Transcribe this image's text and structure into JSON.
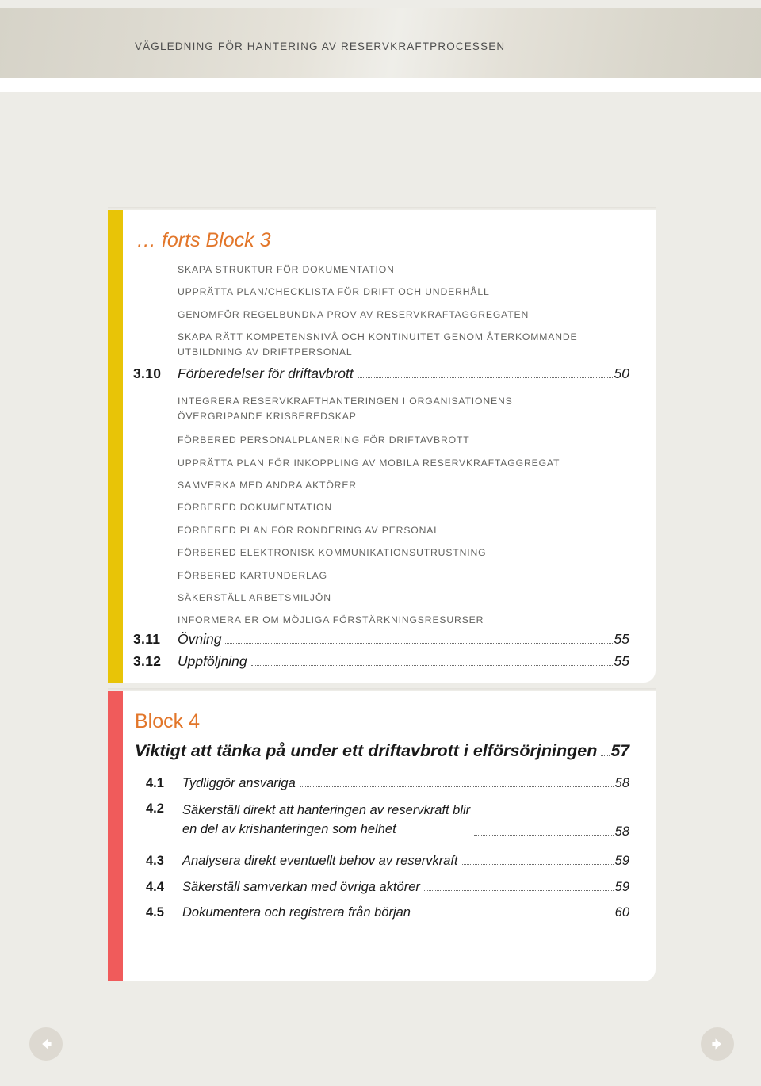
{
  "header": {
    "running_title": "VÄGLEDNING FÖR HANTERING AV RESERVKRAFTPROCESSEN"
  },
  "colors": {
    "page_background": "#edece7",
    "card_background": "#ffffff",
    "block3_bar": "#e8c407",
    "block4_bar": "#f05b5b",
    "heading_orange": "#e2762a",
    "body_text": "#1a1a1a",
    "subitem_text": "#62625f",
    "nav_button": "#ddd9d1"
  },
  "block3": {
    "heading": "… forts Block 3",
    "lead_subitems": [
      "SKAPA STRUKTUR FÖR DOKUMENTATION",
      "UPPRÄTTA PLAN/CHECKLISTA FÖR DRIFT OCH UNDERHÅLL",
      "GENOMFÖR REGELBUNDNA PROV AV RESERVKRAFTAGGREGATEN",
      "SKAPA RÄTT KOMPETENSNIVÅ OCH KONTINUITET GENOM ÅTERKOMMANDE\nUTBILDNING AV DRIFTPERSONAL"
    ],
    "entry_310": {
      "number": "3.10",
      "title": "Förberedelser för driftavbrott",
      "page": "50"
    },
    "subitems_310": [
      "INTEGRERA RESERVKRAFTHANTERINGEN I ORGANISATIONENS\nÖVERGRIPANDE KRISBEREDSKAP",
      "FÖRBERED PERSONALPLANERING FÖR DRIFTAVBROTT",
      "UPPRÄTTA PLAN FÖR INKOPPLING AV MOBILA RESERVKRAFTAGGREGAT",
      "SAMVERKA MED ANDRA AKTÖRER",
      "FÖRBERED DOKUMENTATION",
      "FÖRBERED PLAN FÖR RONDERING AV PERSONAL",
      "FÖRBERED ELEKTRONISK KOMMUNIKATIONSUTRUSTNING",
      "FÖRBERED KARTUNDERLAG",
      "SÄKERSTÄLL ARBETSMILJÖN",
      "INFORMERA ER OM MÖJLIGA FÖRSTÄRKNINGSRESURSER"
    ],
    "entry_311": {
      "number": "3.11",
      "title": "Övning",
      "page": "55"
    },
    "entry_312": {
      "number": "3.12",
      "title": "Uppföljning",
      "page": "55"
    }
  },
  "block4": {
    "heading": "Block 4",
    "main_entry": {
      "title": "Viktigt att tänka på under ett driftavbrott i elförsörjningen",
      "page": "57"
    },
    "entries": [
      {
        "number": "4.1",
        "title": "Tydliggör ansvariga",
        "page": "58"
      },
      {
        "number": "4.2",
        "title": "Säkerställ direkt att hanteringen av reservkraft blir\nen del av krishanteringen som helhet",
        "page": "58"
      },
      {
        "number": "4.3",
        "title": "Analysera direkt eventuellt behov av reservkraft",
        "page": "59"
      },
      {
        "number": "4.4",
        "title": "Säkerställ samverkan med övriga aktörer",
        "page": "59"
      },
      {
        "number": "4.5",
        "title": "Dokumentera och registrera från början",
        "page": "60"
      }
    ]
  },
  "navigation": {
    "prev_label": "arrow-left-icon",
    "next_label": "arrow-right-icon"
  }
}
